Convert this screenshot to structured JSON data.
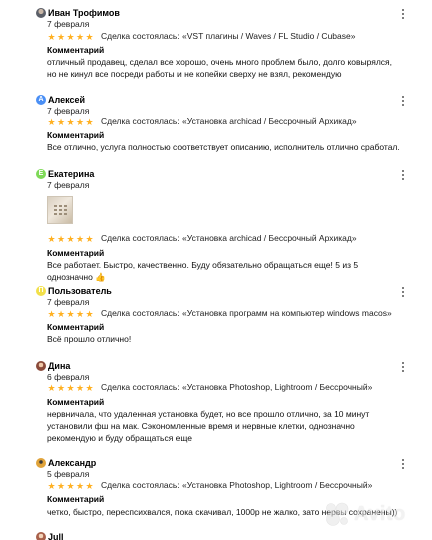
{
  "reviews": [
    {
      "name": "Иван Трофимов",
      "date": "7 февраля",
      "avatar": "photo-avatar",
      "avatar_color": "#6b6f78",
      "stars": 5,
      "deal": "Сделка состоялась: «VST плагины / Waves / FL Studio / Cubase»",
      "comment_label": "Комментарий",
      "comment": "отличный продавец, сделал все хорошо, очень много проблем было, долго ковырялся, но не кинул все посреди работы и не копейки сверху не взял, рекомендую"
    },
    {
      "name": "Алексей",
      "date": "7 февраля",
      "avatar": "letter-avatar",
      "avatar_letter": "А",
      "avatar_color": "#4a8ff5",
      "stars": 5,
      "deal": "Сделка состоялась: «Установка archicad / Бессрочный Архикад»",
      "comment_label": "Комментарий",
      "comment": "Все отлично, услуга полностью соответствует описанию, исполнитель отлично сработал."
    },
    {
      "name": "Екатерина",
      "date": "7 февраля",
      "avatar": "letter-avatar",
      "avatar_letter": "Е",
      "avatar_color": "#7ed957",
      "stars": 5,
      "has_photo": true,
      "deal": "Сделка состоялась: «Установка archicad / Бессрочный Архикад»",
      "comment_label": "Комментарий",
      "comment": "Все работает. Быстро, качественно. Буду обязательно обращаться еще! 5 из 5 однозначно 👍"
    },
    {
      "name": "Пользователь",
      "date": "7 февраля",
      "avatar": "letter-avatar",
      "avatar_letter": "П",
      "avatar_color": "#f2e04a",
      "stars": 5,
      "deal": "Сделка состоялась: «Установка программ на компьютер windows macos»",
      "comment_label": "Комментарий",
      "comment": "Всё прошло отлично!"
    },
    {
      "name": "Дина",
      "date": "6 февраля",
      "avatar": "photo-avatar",
      "avatar_color": "#b07a5a",
      "stars": 5,
      "deal": "Сделка состоялась: «Установка Photoshop, Lightroom / Бессрочный»",
      "comment_label": "Комментарий",
      "comment": "нервничала, что удаленная установка будет, но все прошло отлично, за 10 минут установили фш на мак. Сэкономленные время и нервные клетки, однозначно рекомендую и буду обращаться еще"
    },
    {
      "name": "Александр",
      "date": "5 февраля",
      "avatar": "photo-avatar",
      "avatar_color": "#e0a33a",
      "stars": 5,
      "deal": "Сделка состоялась: «Установка Photoshop, Lightroom / Бессрочный»",
      "comment_label": "Комментарий",
      "comment": "четко, быстро, переспсихвался, пока скачивал, 1000р не жалко, зато нервы сохранены))"
    },
    {
      "name": "Jull",
      "avatar": "photo-avatar",
      "avatar_color": "#c98a6a"
    }
  ],
  "star_color": "#ffb021",
  "watermark": "Avito"
}
